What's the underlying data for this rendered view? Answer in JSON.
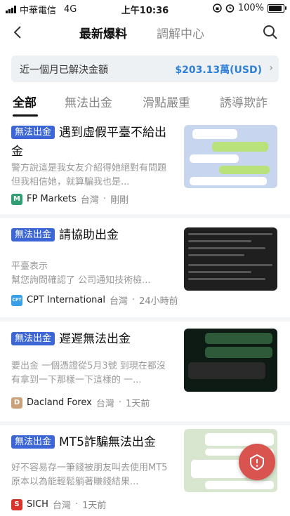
{
  "status_bar": {
    "carrier": "中華電信",
    "network": "4G",
    "time": "上午10:36",
    "battery": "100%",
    "battery_level": 1.0
  },
  "header": {
    "tab_active": "最新爆料",
    "tab_inactive": "調解中心"
  },
  "summary": {
    "label": "近一個月已解決金額",
    "amount": "$203.13萬(USD)"
  },
  "category_tabs": [
    "全部",
    "無法出金",
    "滑點嚴重",
    "誘導欺詐"
  ],
  "posts": [
    {
      "tag": "無法出金",
      "title": "遇到虛假平臺不給出金",
      "desc": "警方說這是我女友介紹得她絕對有問題但我相信她，就算騙我也是...",
      "broker": "FP Markets",
      "region": "台灣",
      "time": "剛剛",
      "logo_letter": "M",
      "logo_color": "#2f9f73"
    },
    {
      "tag": "無法出金",
      "title": "請協助出金",
      "desc": "平臺表示\n幫您詢問確認了 公司通知技術檢...",
      "broker": "CPT International",
      "region": "台灣",
      "time": "24小時前",
      "logo_letter": "CPT",
      "logo_color": "#3aa0e8"
    },
    {
      "tag": "無法出金",
      "title": "遲遲無法出金",
      "desc": "要出金 一個憑證從5月3號 到現在都沒有拿到一下那樣一下這樣的 一...",
      "broker": "Dacland Forex",
      "region": "台灣",
      "time": "1天前",
      "logo_letter": "D",
      "logo_color": "#c9a27a"
    },
    {
      "tag": "無法出金",
      "title": "MT5詐騙無法出金",
      "desc": "好不容易存一筆錢被朋友叫去使用MT5原本以為能輕鬆躺著賺錢結果...",
      "broker": "SICH",
      "region": "台灣",
      "time": "1天前",
      "logo_letter": "S",
      "logo_color": "#d9342b"
    }
  ],
  "colors": {
    "accent": "#2d7fd8",
    "tag": "#3c66d6",
    "float": "#d9534f"
  }
}
